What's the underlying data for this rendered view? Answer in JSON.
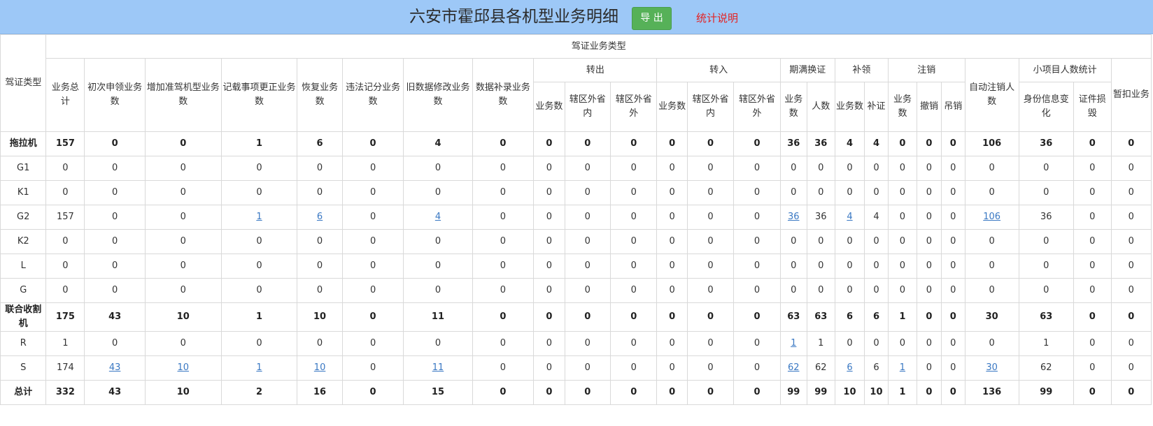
{
  "header": {
    "title": "六安市霍邱县各机型业务明细",
    "export_label": "导 出",
    "stat_link": "统计说明"
  },
  "colors": {
    "header_bg": "#9dc8f7",
    "export_btn": "#56b158",
    "stat_link": "#e42222",
    "link": "#3a78c3"
  },
  "table": {
    "col_type": "驾证类型",
    "group_title": "驾证业务类型",
    "headers": {
      "total": "业务总计",
      "first_apply": "初次申领业务数",
      "add_model": "增加准驾机型业务数",
      "record_change": "记载事项更正业务数",
      "restore": "恢复业务数",
      "violation": "违法记分业务数",
      "old_modify": "旧数据修改业务数",
      "data_supplement": "数据补录业务数",
      "transfer_out": "转出",
      "transfer_in": "转入",
      "renewal": "期满换证",
      "reissue": "补领",
      "cancel": "注销",
      "auto_cancel": "自动注销人数",
      "small_stats": "小项目人数统计",
      "suspend": "暂扣业务",
      "sub_biz": "业务数",
      "sub_out_in": "辖区外省内",
      "sub_out_out": "辖区外省外",
      "sub_people": "人数",
      "sub_reissue": "补证",
      "sub_revoke": "撤销",
      "sub_hang": "吊销",
      "sub_id_change": "身份信息变化",
      "sub_damage": "证件损毁"
    },
    "rows": [
      {
        "name": "拖拉机",
        "bold": true,
        "cells": [
          "157",
          "0",
          "0",
          "1",
          "6",
          "0",
          "4",
          "0",
          "0",
          "0",
          "0",
          "0",
          "0",
          "0",
          "36",
          "36",
          "4",
          "4",
          "0",
          "0",
          "0",
          "106",
          "36",
          "0",
          "0"
        ],
        "links": []
      },
      {
        "name": "G1",
        "bold": false,
        "cells": [
          "0",
          "0",
          "0",
          "0",
          "0",
          "0",
          "0",
          "0",
          "0",
          "0",
          "0",
          "0",
          "0",
          "0",
          "0",
          "0",
          "0",
          "0",
          "0",
          "0",
          "0",
          "0",
          "0",
          "0",
          "0"
        ],
        "links": []
      },
      {
        "name": "K1",
        "bold": false,
        "cells": [
          "0",
          "0",
          "0",
          "0",
          "0",
          "0",
          "0",
          "0",
          "0",
          "0",
          "0",
          "0",
          "0",
          "0",
          "0",
          "0",
          "0",
          "0",
          "0",
          "0",
          "0",
          "0",
          "0",
          "0",
          "0"
        ],
        "links": []
      },
      {
        "name": "G2",
        "bold": false,
        "cells": [
          "157",
          "0",
          "0",
          "1",
          "6",
          "0",
          "4",
          "0",
          "0",
          "0",
          "0",
          "0",
          "0",
          "0",
          "36",
          "36",
          "4",
          "4",
          "0",
          "0",
          "0",
          "106",
          "36",
          "0",
          "0"
        ],
        "links": [
          3,
          4,
          6,
          14,
          16,
          21
        ]
      },
      {
        "name": "K2",
        "bold": false,
        "cells": [
          "0",
          "0",
          "0",
          "0",
          "0",
          "0",
          "0",
          "0",
          "0",
          "0",
          "0",
          "0",
          "0",
          "0",
          "0",
          "0",
          "0",
          "0",
          "0",
          "0",
          "0",
          "0",
          "0",
          "0",
          "0"
        ],
        "links": []
      },
      {
        "name": "L",
        "bold": false,
        "cells": [
          "0",
          "0",
          "0",
          "0",
          "0",
          "0",
          "0",
          "0",
          "0",
          "0",
          "0",
          "0",
          "0",
          "0",
          "0",
          "0",
          "0",
          "0",
          "0",
          "0",
          "0",
          "0",
          "0",
          "0",
          "0"
        ],
        "links": []
      },
      {
        "name": "G",
        "bold": false,
        "cells": [
          "0",
          "0",
          "0",
          "0",
          "0",
          "0",
          "0",
          "0",
          "0",
          "0",
          "0",
          "0",
          "0",
          "0",
          "0",
          "0",
          "0",
          "0",
          "0",
          "0",
          "0",
          "0",
          "0",
          "0",
          "0"
        ],
        "links": []
      },
      {
        "name": "联合收割机",
        "bold": true,
        "tall": true,
        "cells": [
          "175",
          "43",
          "10",
          "1",
          "10",
          "0",
          "11",
          "0",
          "0",
          "0",
          "0",
          "0",
          "0",
          "0",
          "63",
          "63",
          "6",
          "6",
          "1",
          "0",
          "0",
          "30",
          "63",
          "0",
          "0"
        ],
        "links": []
      },
      {
        "name": "R",
        "bold": false,
        "cells": [
          "1",
          "0",
          "0",
          "0",
          "0",
          "0",
          "0",
          "0",
          "0",
          "0",
          "0",
          "0",
          "0",
          "0",
          "1",
          "1",
          "0",
          "0",
          "0",
          "0",
          "0",
          "0",
          "1",
          "0",
          "0"
        ],
        "links": [
          14
        ]
      },
      {
        "name": "S",
        "bold": false,
        "cells": [
          "174",
          "43",
          "10",
          "1",
          "10",
          "0",
          "11",
          "0",
          "0",
          "0",
          "0",
          "0",
          "0",
          "0",
          "62",
          "62",
          "6",
          "6",
          "1",
          "0",
          "0",
          "30",
          "62",
          "0",
          "0"
        ],
        "links": [
          1,
          2,
          3,
          4,
          6,
          14,
          16,
          18,
          21
        ]
      },
      {
        "name": "总计",
        "bold": true,
        "cells": [
          "332",
          "43",
          "10",
          "2",
          "16",
          "0",
          "15",
          "0",
          "0",
          "0",
          "0",
          "0",
          "0",
          "0",
          "99",
          "99",
          "10",
          "10",
          "1",
          "0",
          "0",
          "136",
          "99",
          "0",
          "0"
        ],
        "links": []
      }
    ]
  }
}
